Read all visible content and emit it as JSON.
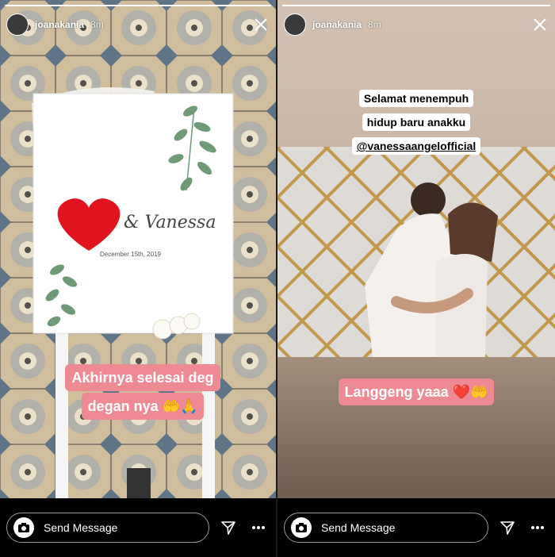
{
  "stories": [
    {
      "username": "joanakania",
      "time": "8m",
      "caption_lines": [
        "Akhirnya selesai deg",
        "degan nya 🤲🙏"
      ],
      "sign": {
        "names": "& Vanessa",
        "date": "December 15th, 2019"
      },
      "footer": {
        "placeholder": "Send Message"
      }
    },
    {
      "username": "joanakania",
      "time": "8m",
      "caption_top_lines": [
        "Selamat menempuh",
        "hidup baru anakku",
        "@vanessaangelofficial"
      ],
      "caption_bottom": "Langgeng yaaa ❤️🤲",
      "footer": {
        "placeholder": "Send Message"
      }
    }
  ],
  "colors": {
    "caption_pink": "#ee8a93",
    "story_bg": "#000000"
  },
  "icons": [
    "close-icon",
    "camera-icon",
    "direct-send-icon",
    "more-icon",
    "heart-icon"
  ]
}
